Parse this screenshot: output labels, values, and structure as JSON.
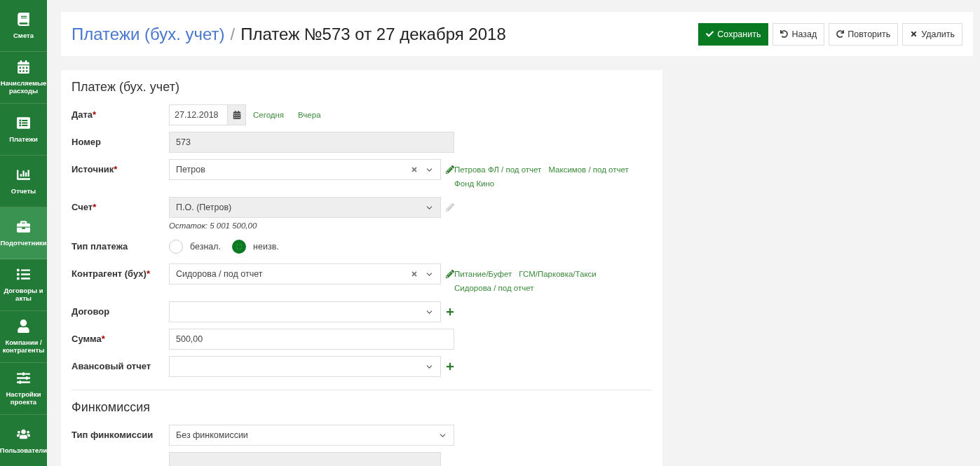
{
  "sidebar": {
    "items": [
      {
        "label": "Смета",
        "selected": false
      },
      {
        "label": "Начисляемые расходы",
        "selected": false
      },
      {
        "label": "Платежи",
        "selected": false
      },
      {
        "label": "Отчеты",
        "selected": false
      },
      {
        "label": "Подотчетники",
        "selected": true
      },
      {
        "label": "Договоры и акты",
        "selected": false
      },
      {
        "label": "Компании / контрагенты",
        "selected": false
      },
      {
        "label": "Настройки проекта",
        "selected": false
      },
      {
        "label": "Пользователи",
        "selected": false
      }
    ]
  },
  "header": {
    "breadcrumb": "Платежи (бух. учет)",
    "separator": "/",
    "title": "Платеж №573 от 27 декабря 2018",
    "buttons": [
      {
        "label": "Сохранить",
        "kind": "save"
      },
      {
        "label": "Назад",
        "kind": "back"
      },
      {
        "label": "Повторить",
        "kind": "repeat"
      },
      {
        "label": "Удалить",
        "kind": "delete"
      }
    ]
  },
  "sections": [
    {
      "title": "Платеж (бух. учет)",
      "fields": [
        {
          "kind": "date",
          "label": "Дата",
          "required_mark": "*",
          "value": "27.12.2018",
          "links": [
            "Сегодня",
            "Вчера"
          ]
        },
        {
          "kind": "text",
          "label": "Номер",
          "value": "573",
          "disabled": true
        },
        {
          "kind": "select",
          "label": "Источник",
          "required_mark": "*",
          "value": "Петров",
          "clearable": true,
          "disabled": false,
          "edit_enabled": true,
          "links": [
            "Петрова ФЛ / под отчет",
            "Максимов / под отчет",
            "Фонд Кино"
          ]
        },
        {
          "kind": "select",
          "label": "Счет",
          "required_mark": "*",
          "value": "П.О. (Петров)",
          "disabled": true,
          "edit_enabled": false,
          "hint": "Остаток: 5 001 500,00"
        },
        {
          "kind": "radio",
          "label": "Тип платежа",
          "options": [
            {
              "label": "безнал.",
              "selected": false
            },
            {
              "label": "неизв.",
              "selected": true
            }
          ]
        },
        {
          "kind": "select",
          "label": "Контрагент (бух)",
          "required_mark": "*",
          "value": "Сидорова / под отчет",
          "clearable": true,
          "disabled": false,
          "edit_enabled": true,
          "links": [
            "Питание/Буфет",
            "ГСМ/Парковка/Такси",
            "Сидорова / под отчет"
          ]
        },
        {
          "kind": "select",
          "label": "Договор",
          "disabled": false,
          "add": true
        },
        {
          "kind": "text",
          "label": "Сумма",
          "required_mark": "*",
          "value": "500,00",
          "disabled": false
        },
        {
          "kind": "select",
          "label": "Авансовый отчет",
          "disabled": false,
          "add": true
        }
      ]
    },
    {
      "title": "Финкомиссия",
      "fields": [
        {
          "kind": "select",
          "label": "Тип финкомиссии",
          "value": "Без финкомиссии",
          "disabled": false
        },
        {
          "kind": "blank"
        }
      ]
    }
  ]
}
